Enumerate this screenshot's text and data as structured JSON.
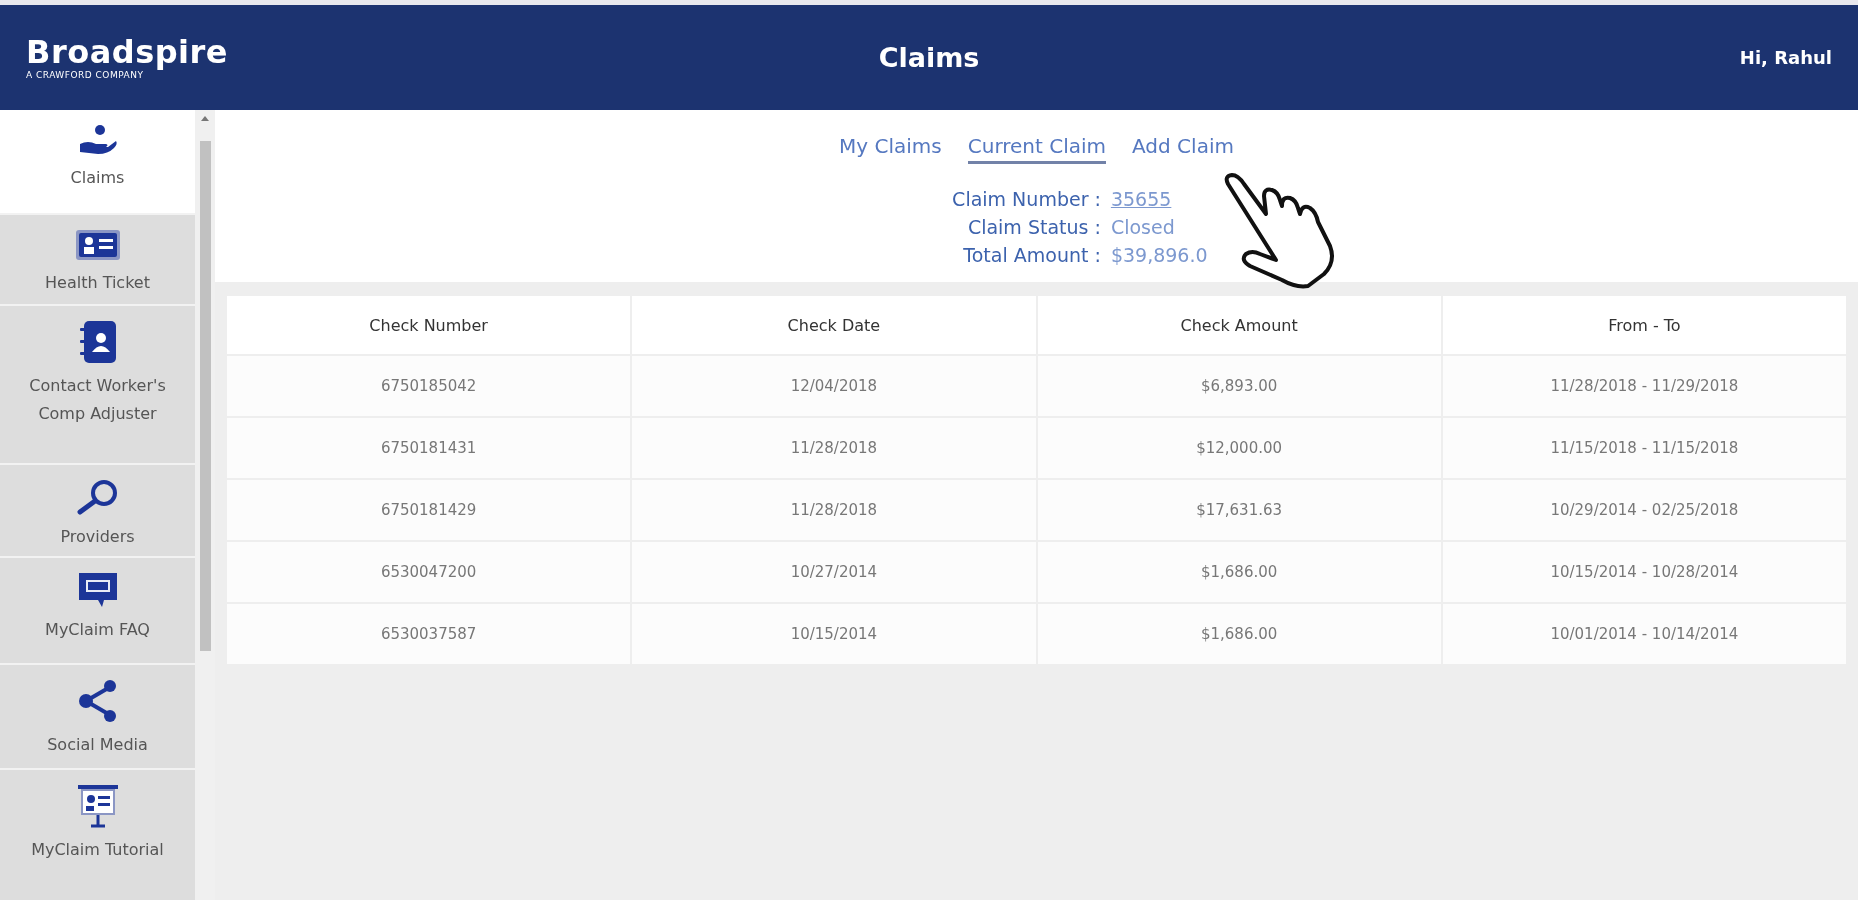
{
  "header": {
    "logo": "Broadspire",
    "tagline": "A CRAWFORD COMPANY",
    "title": "Claims",
    "greeting": "Hi, Rahul"
  },
  "sidebar": {
    "items": [
      {
        "label": "Claims",
        "selected": true
      },
      {
        "label": "Health Ticket",
        "selected": false
      },
      {
        "label": "Contact Worker's Comp Adjuster",
        "selected": false
      },
      {
        "label": "Providers",
        "selected": false
      },
      {
        "label": "MyClaim FAQ",
        "selected": false
      },
      {
        "label": "Social Media",
        "selected": false
      },
      {
        "label": "MyClaim Tutorial",
        "selected": false
      }
    ]
  },
  "tabs": [
    {
      "label": "My Claims",
      "selected": false
    },
    {
      "label": "Current Claim",
      "selected": true
    },
    {
      "label": "Add Claim",
      "selected": false
    }
  ],
  "claim_info": [
    {
      "label": "Claim Number :",
      "value": "35655",
      "link": true
    },
    {
      "label": "Claim Status :",
      "value": "Closed",
      "link": false
    },
    {
      "label": "Total Amount :",
      "value": "$39,896.0",
      "link": false
    }
  ],
  "table": {
    "columns": [
      "Check Number",
      "Check Date",
      "Check Amount",
      "From - To"
    ],
    "rows": [
      [
        "6750185042",
        "12/04/2018",
        "$6,893.00",
        "11/28/2018 - 11/29/2018"
      ],
      [
        "6750181431",
        "11/28/2018",
        "$12,000.00",
        "11/15/2018 - 11/15/2018"
      ],
      [
        "6750181429",
        "11/28/2018",
        "$17,631.63",
        "10/29/2014 - 02/25/2018"
      ],
      [
        "6530047200",
        "10/27/2014",
        "$1,686.00",
        "10/15/2014 - 10/28/2014"
      ],
      [
        "6530037587",
        "10/15/2014",
        "$1,686.00",
        "10/01/2014 - 10/14/2014"
      ]
    ]
  }
}
